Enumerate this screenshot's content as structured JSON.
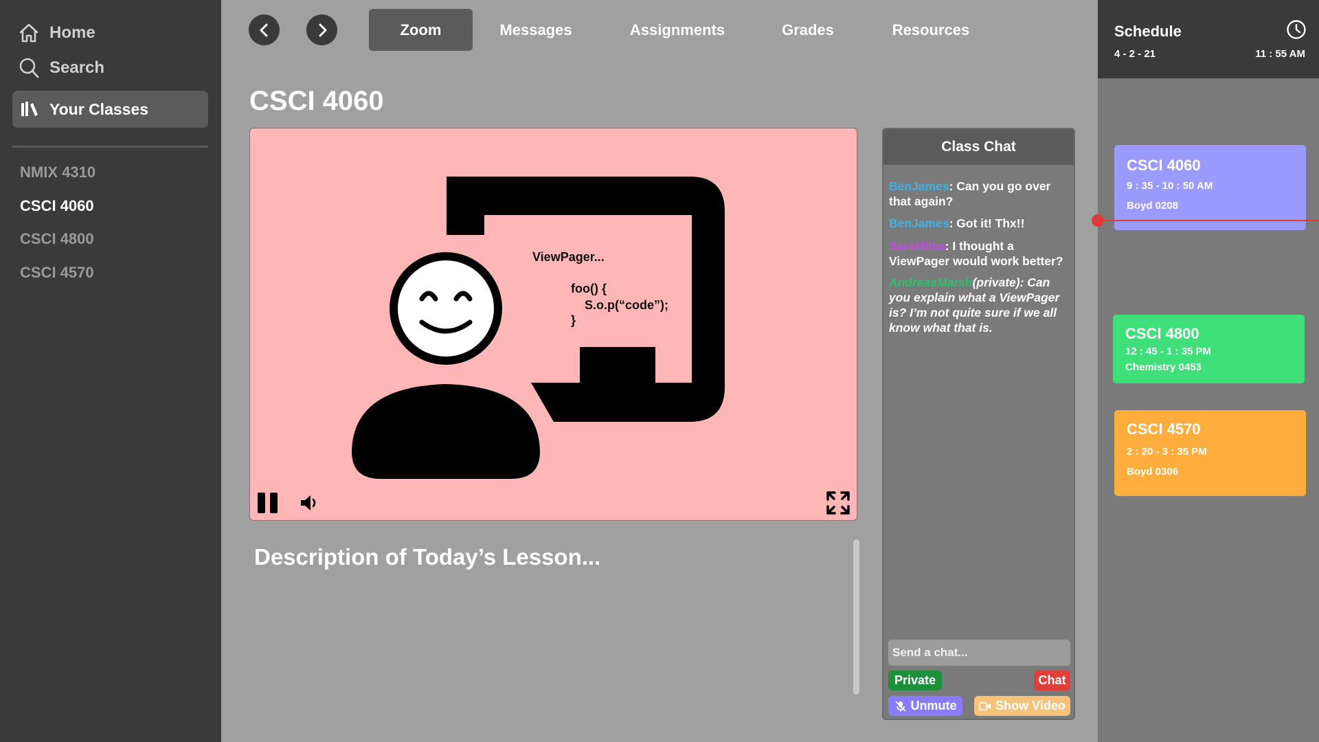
{
  "sidebar": {
    "home_label": "Home",
    "search_label": "Search",
    "your_classes_label": "Your Classes",
    "classes": [
      "NMIX 4310",
      "CSCI 4060",
      "CSCI 4800",
      "CSCI 4570"
    ]
  },
  "tabs": [
    "Zoom",
    "Messages",
    "Assignments",
    "Grades",
    "Resources"
  ],
  "page_title": "CSCI 4060",
  "video": {
    "board_title": "ViewPager...",
    "code": [
      "foo() {",
      "    S.o.p(“code”);",
      "}"
    ]
  },
  "description": "Description of Today’s Lesson...",
  "chat": {
    "title": "Class Chat",
    "messages": [
      {
        "user": "BenJames",
        "sep": ": ",
        "text": "Can you go over that again?",
        "color": "#3bb3e6"
      },
      {
        "user": "BenJames",
        "sep": ": ",
        "text": "Got it! Thx!!",
        "color": "#3bb3e6"
      },
      {
        "user": "SaraMiles",
        "sep": ": ",
        "text": "I thought a ViewPager would work better?",
        "color": "#c04ee0"
      },
      {
        "user": "AndreasMarsh",
        "sep": "",
        "text": "(private): Can you explain what a ViewPager is? I’m not quite sure if we all know what that is.",
        "color": "#2fbf6a"
      }
    ],
    "input_placeholder": "Send a chat...",
    "private_label": "Private",
    "chat_label": "Chat",
    "unmute_label": "Unmute",
    "show_video_label": "Show Video"
  },
  "schedule": {
    "title": "Schedule",
    "date": "4 - 2 - 21",
    "time": "11 : 55 AM",
    "cards": [
      {
        "course": "CSCI 4060",
        "time": "9 : 35 - 10 : 50 AM",
        "room": "Boyd 0208",
        "color": "#9a9aff"
      },
      {
        "course": "CSCI 4800",
        "time": "12 : 45 - 1 : 35 PM",
        "room": "Chemistry 0453",
        "color": "#3fe07a"
      },
      {
        "course": "CSCI 4570",
        "time": "2 : 20 - 3 : 35 PM",
        "room": "Boyd 0306",
        "color": "#ffad3c"
      }
    ]
  },
  "colors": {
    "private": "#1e8f3c",
    "chat": "#e0403c",
    "unmute": "#8a7cff",
    "show_video": "#f7c27a"
  }
}
